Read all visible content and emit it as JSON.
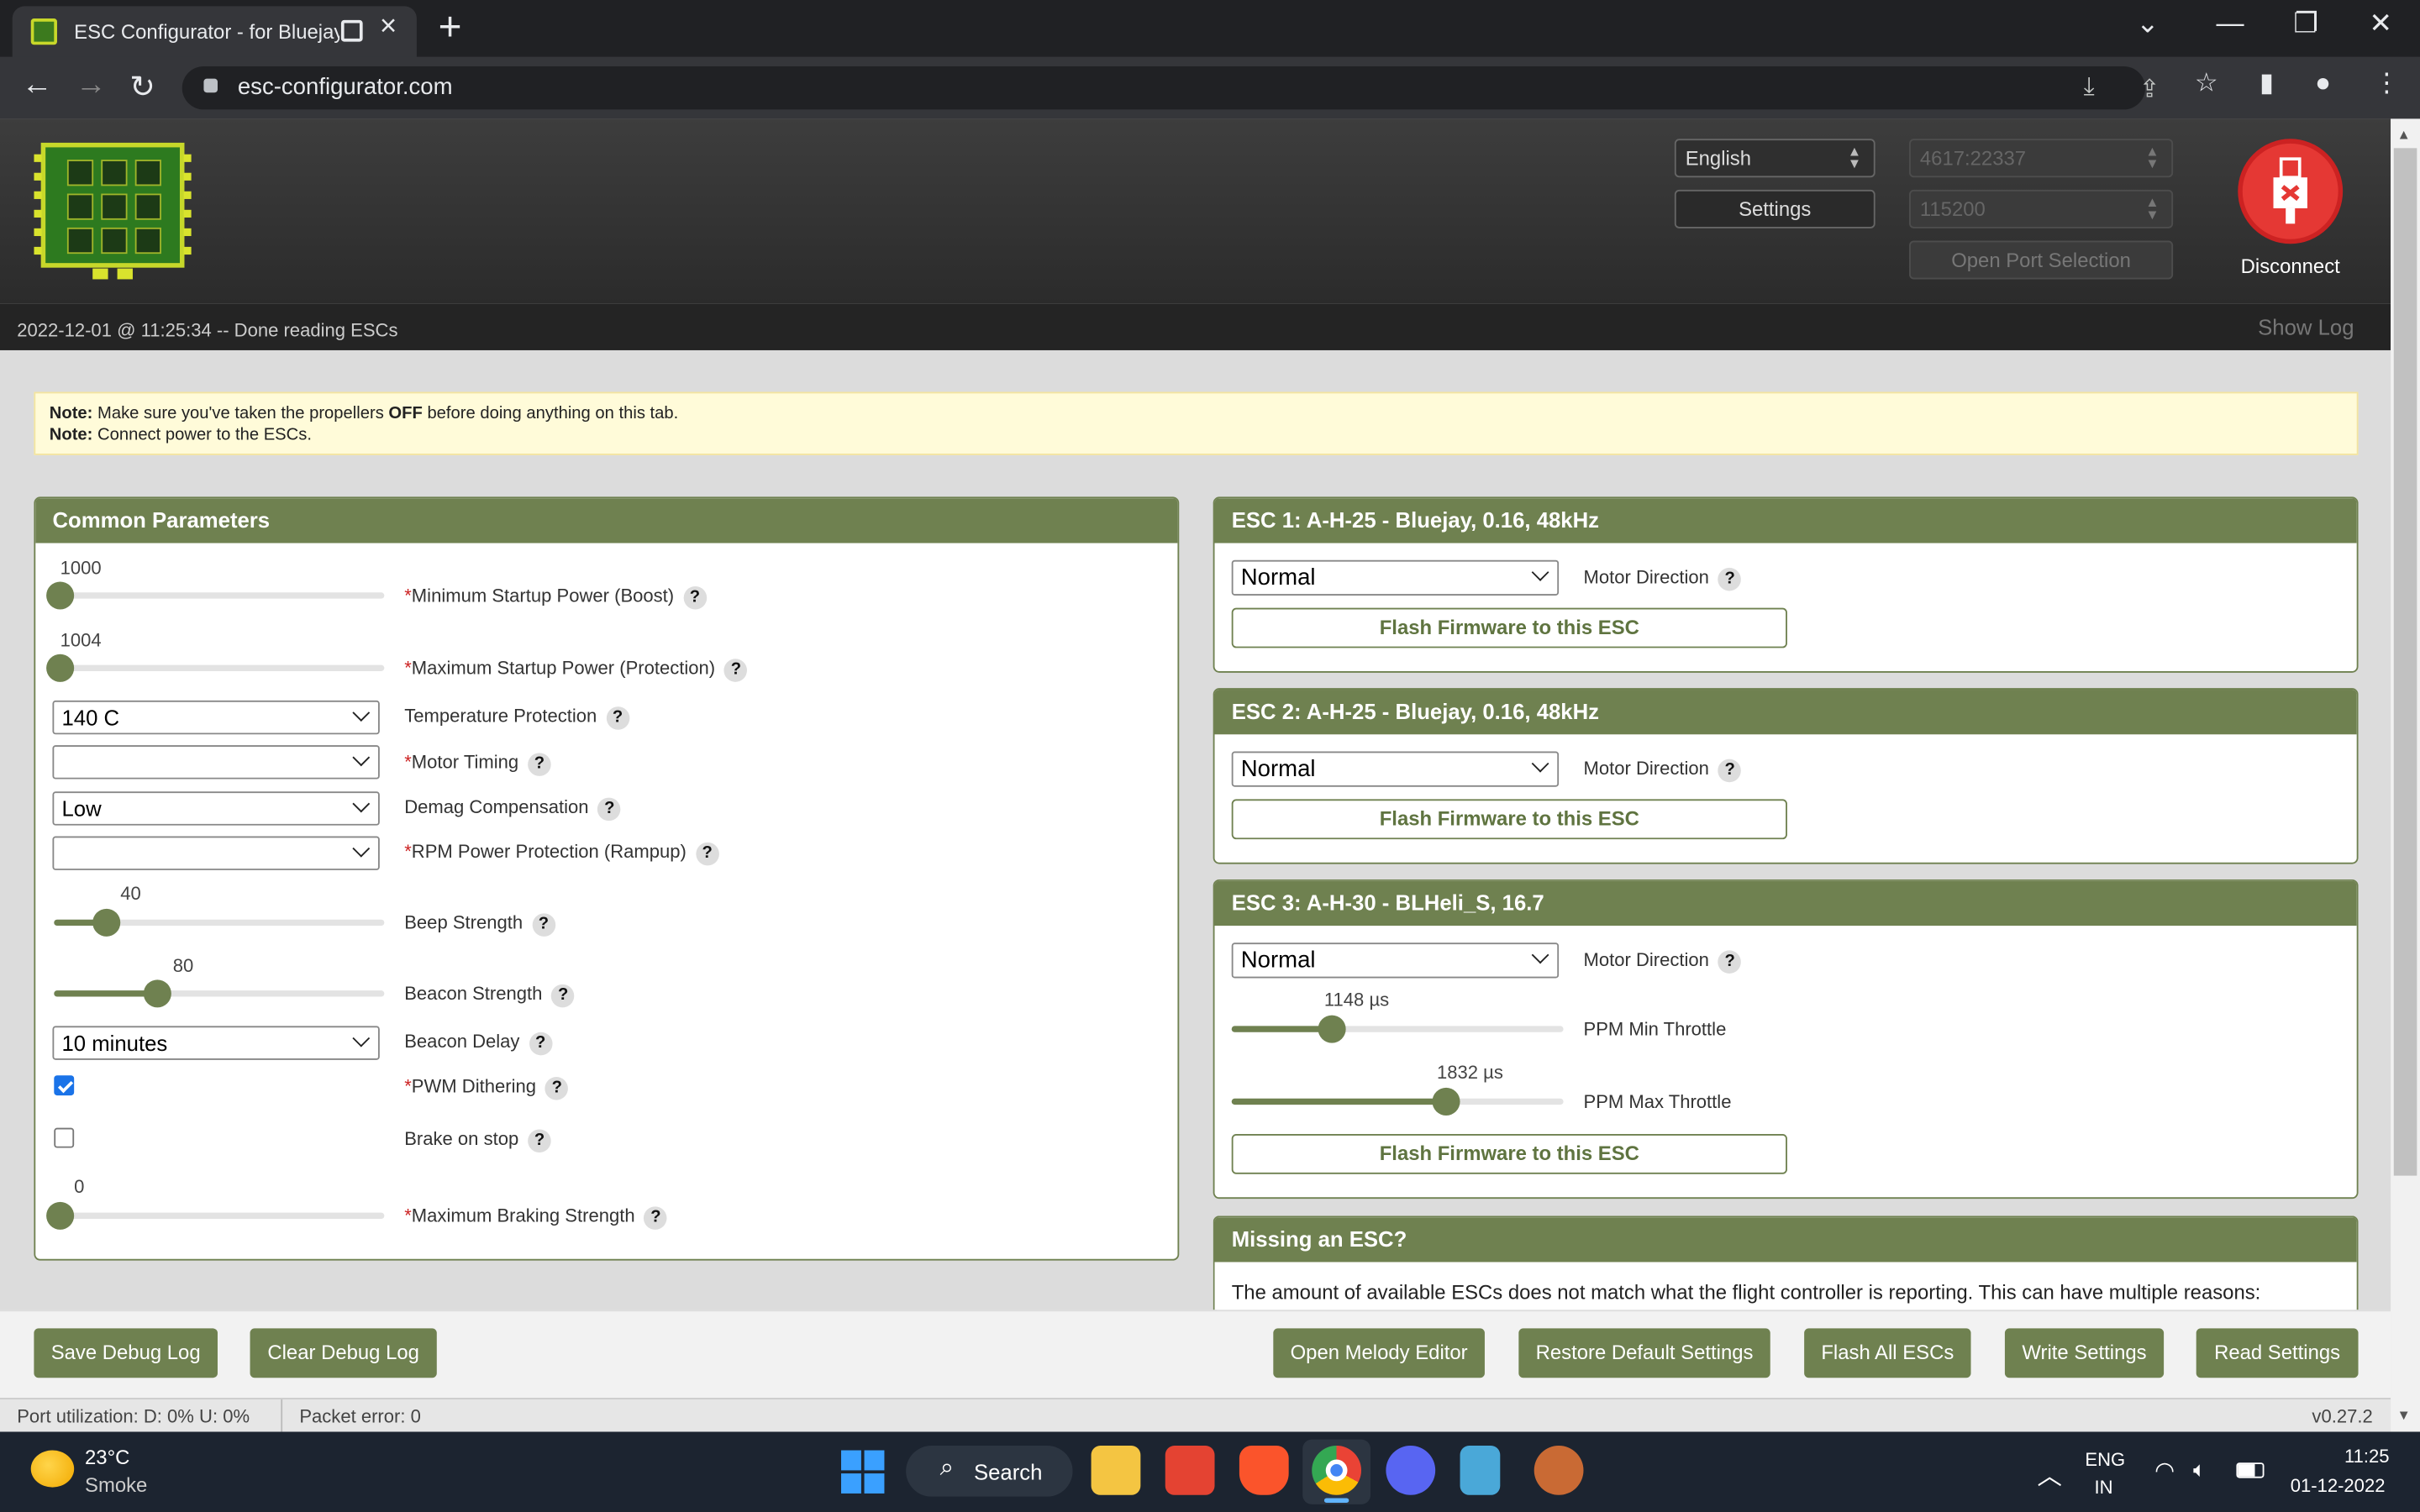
{
  "browser": {
    "tab_title": "ESC Configurator - for Bluejay",
    "url": "esc-configurator.com"
  },
  "header": {
    "language": "English",
    "settings_label": "Settings",
    "port": "4617:22337",
    "baud": "115200",
    "open_port_label": "Open Port Selection",
    "disconnect_label": "Disconnect"
  },
  "status": {
    "message": "2022-12-01 @ 11:25:34 -- Done reading ESCs",
    "show_log": "Show Log"
  },
  "notes": {
    "n1_prefix": "Note:",
    "n1_text": " Make sure you've taken the propellers ",
    "n1_bold": "OFF",
    "n1_suffix": " before doing anything on this tab.",
    "n2_prefix": "Note:",
    "n2_text": " Connect power to the ESCs."
  },
  "common": {
    "title": "Common Parameters",
    "min_startup": {
      "value": "1000",
      "label": "Minimum Startup Power (Boost)",
      "fraction": 0.0
    },
    "max_startup": {
      "value": "1004",
      "label": "Maximum Startup Power (Protection)",
      "fraction": 0.0
    },
    "temp": {
      "value": "140 C",
      "label": "Temperature Protection"
    },
    "timing": {
      "value": "",
      "label": "Motor Timing"
    },
    "demag": {
      "value": "Low",
      "label": "Demag Compensation"
    },
    "rpm": {
      "value": "",
      "label": "RPM Power Protection (Rampup)"
    },
    "beep": {
      "value": "40",
      "label": "Beep Strength",
      "fraction": 0.16
    },
    "beacon": {
      "value": "80",
      "label": "Beacon Strength",
      "fraction": 0.31
    },
    "beacon_delay": {
      "value": "10 minutes",
      "label": "Beacon Delay"
    },
    "pwm": {
      "label": "PWM Dithering",
      "checked": true
    },
    "brake": {
      "label": "Brake on stop",
      "checked": false
    },
    "max_brake": {
      "value": "0",
      "label": "Maximum Braking Strength",
      "fraction": 0.0
    }
  },
  "escs": [
    {
      "title": "ESC 1: A-H-25 - Bluejay, 0.16, 48kHz",
      "direction": "Normal",
      "direction_label": "Motor Direction",
      "flash_label": "Flash Firmware to this ESC"
    },
    {
      "title": "ESC 2: A-H-25 - Bluejay, 0.16, 48kHz",
      "direction": "Normal",
      "direction_label": "Motor Direction",
      "flash_label": "Flash Firmware to this ESC"
    },
    {
      "title": "ESC 3: A-H-30 - BLHeli_S, 16.7",
      "direction": "Normal",
      "direction_label": "Motor Direction",
      "flash_label": "Flash Firmware to this ESC",
      "ppm_min": {
        "value": "1148 µs",
        "label": "PPM Min Throttle",
        "fraction": 0.3
      },
      "ppm_max": {
        "value": "1832 µs",
        "label": "PPM Max Throttle",
        "fraction": 0.65
      }
    }
  ],
  "missing": {
    "title": "Missing an ESC?",
    "text": "The amount of available ESCs does not match what the flight controller is reporting. This can have multiple reasons:"
  },
  "buttons": {
    "save_debug": "Save Debug Log",
    "clear_debug": "Clear Debug Log",
    "melody": "Open Melody Editor",
    "restore": "Restore Default Settings",
    "flash_all": "Flash All ESCs",
    "write": "Write Settings",
    "read": "Read Settings"
  },
  "portstatus": {
    "utilization": "Port utilization: D: 0% U: 0%",
    "packet_error": "Packet error: 0",
    "version": "v0.27.2"
  },
  "taskbar": {
    "temp": "23°C",
    "weather": "Smoke",
    "search": "Search",
    "lang1": "ENG",
    "lang2": "IN",
    "time": "11:25",
    "date": "01-12-2022"
  },
  "colors": {
    "accent": "#6f8150",
    "disconnect": "#e53834",
    "note_bg": "#fffbd9"
  },
  "icons": {
    "help": "?",
    "help_marker": "*"
  }
}
